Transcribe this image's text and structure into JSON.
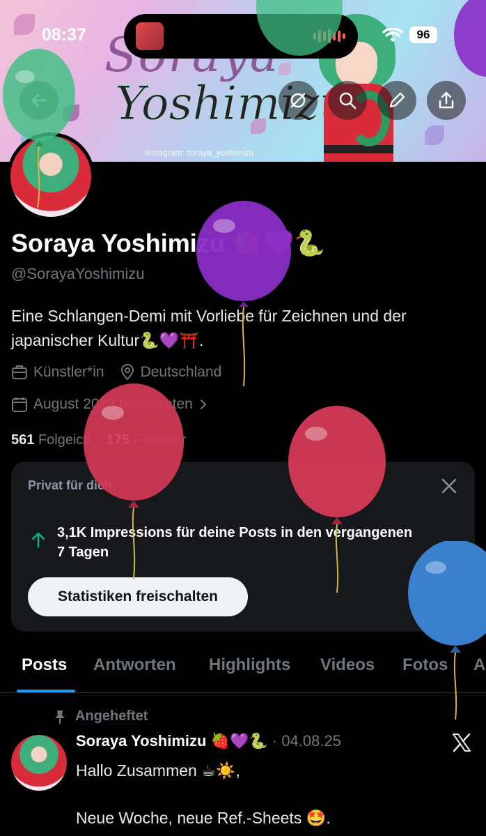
{
  "status": {
    "time": "08:37",
    "battery": "96"
  },
  "banner": {
    "title_line1": "Soraya",
    "title_line2": "Yoshimizu",
    "credit": "Instagram: soraya_yoshimizu"
  },
  "profile": {
    "name": "Soraya Yoshimizu 🍓💜🐍",
    "handle": "@SorayaYoshimizu",
    "bio": "Eine Schlangen-Demi mit Vorliebe für Zeichnen und der japanischer Kultur🐍💜⛩️.",
    "profession": "Künstler*in",
    "location": "Deutschland",
    "joined": "August 2023 beigetreten",
    "following_count": "561",
    "following_label": "Folgeich",
    "followers_count": "175",
    "followers_label": "Follower"
  },
  "card": {
    "label": "Privat für dich",
    "stat": "3,1K Impressions für deine Posts in den vergangenen 7 Tagen",
    "button": "Statistiken freischalten"
  },
  "tabs": [
    "Posts",
    "Antworten",
    "Highlights",
    "Videos",
    "Fotos",
    "A"
  ],
  "post": {
    "pinned_label": "Angeheftet",
    "author": "Soraya Yoshimizu 🍓💜🐍",
    "date": "· 04.08.25",
    "text": "Hallo Zusammen ☕☀️,\n\nNeue Woche, neue Ref.-Sheets 🤩."
  },
  "icons": {
    "back": "back-arrow-icon",
    "grok": "grok-icon",
    "search": "search-icon",
    "edit": "pencil-icon",
    "share": "share-icon",
    "briefcase": "briefcase-icon",
    "location": "location-pin-icon",
    "calendar": "calendar-icon",
    "close": "close-icon",
    "arrow_up": "arrow-up-icon",
    "pin": "pin-icon",
    "x_logo": "x-logo-icon"
  },
  "colors": {
    "accent": "#1d9bf0",
    "card_bg": "#16181c",
    "muted": "#71767b",
    "balloon_purple": "#8a2ec6",
    "balloon_red": "#d53a57",
    "balloon_blue": "#3d86d6",
    "balloon_green": "#3fbf84"
  }
}
